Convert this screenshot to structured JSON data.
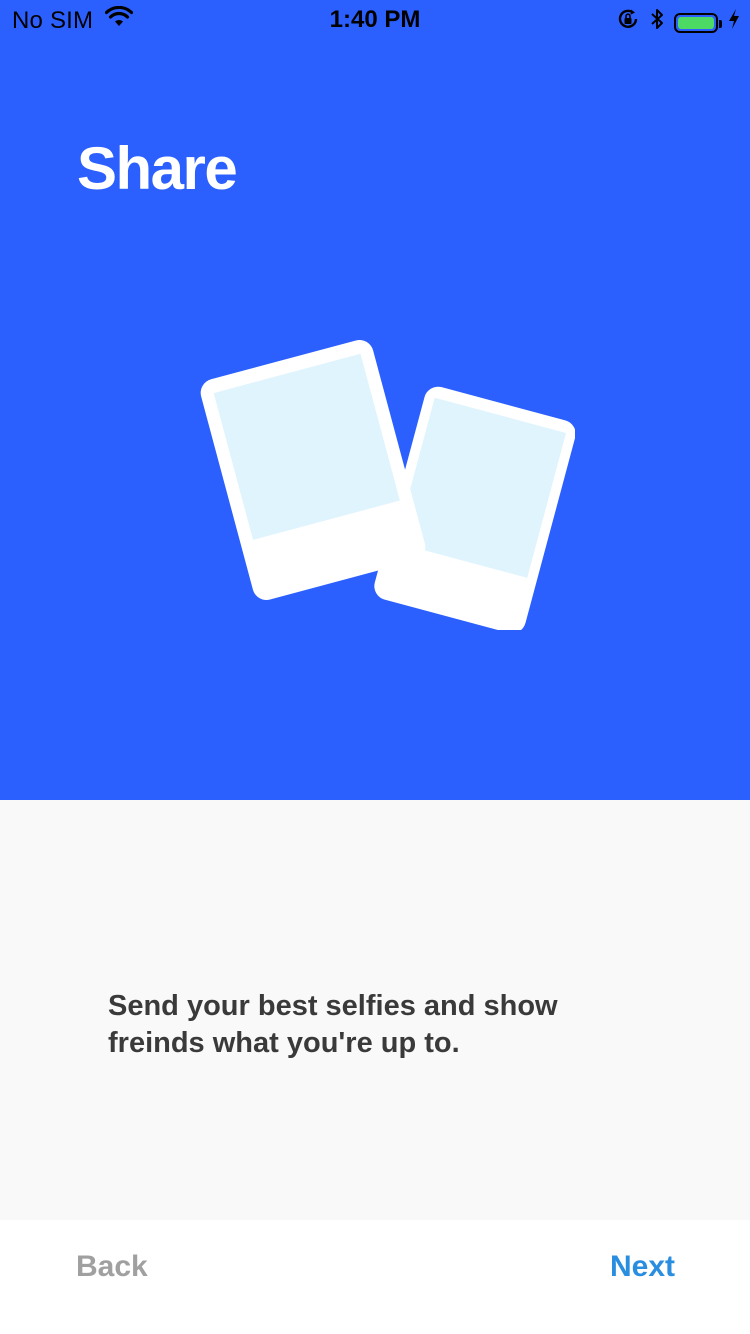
{
  "status_bar": {
    "carrier": "No SIM",
    "time": "1:40 PM",
    "wifi_icon": "wifi-icon",
    "orientation_lock_icon": "orientation-lock-icon",
    "bluetooth_icon": "bluetooth-icon",
    "battery_icon": "battery-icon",
    "charging_icon": "charging-bolt-icon",
    "battery_level": 1.0,
    "battery_color": "#4cd964"
  },
  "hero": {
    "title": "Share",
    "background_color": "#2b60ff",
    "illustration_icon": "photos-icon",
    "photo_frame_color": "#ffffff",
    "photo_image_color": "#e0f4fd"
  },
  "content": {
    "description": "Send your best selfies and show freinds what you're up to.",
    "background_color": "#f9f9f9"
  },
  "footer": {
    "back_label": "Back",
    "next_label": "Next",
    "back_color": "#a0a0a0",
    "next_color": "#2a8ee0"
  }
}
